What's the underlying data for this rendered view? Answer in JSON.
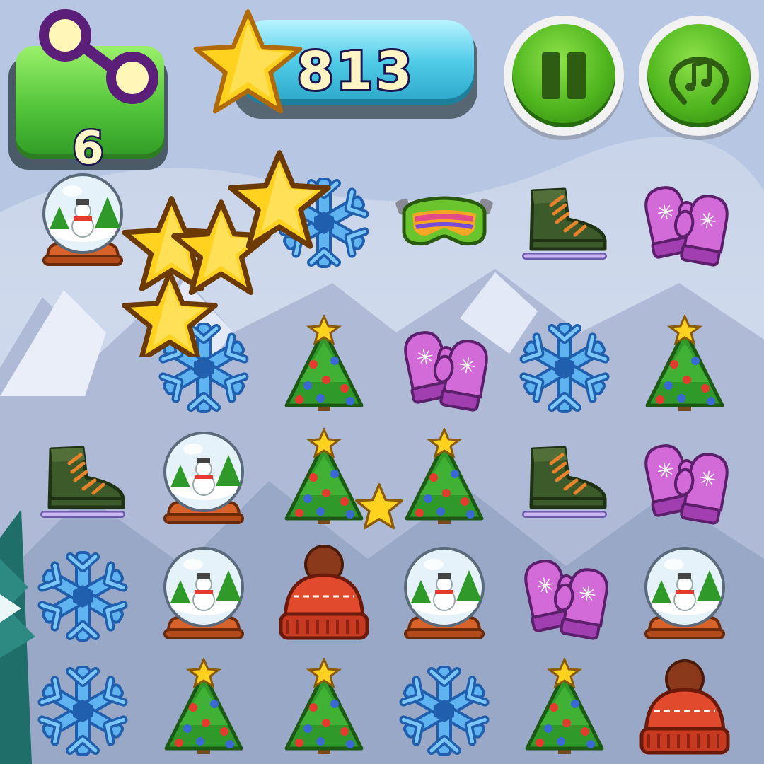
{
  "hud": {
    "moves_left": "6",
    "moves_icon": "link-chain-icon",
    "score": "813",
    "score_icon": "star-icon",
    "pause_icon": "pause-icon",
    "music_icon": "music-note-icon"
  },
  "board": {
    "columns": 6,
    "rows": 5,
    "tiles": [
      [
        "snow-globe",
        "",
        "snowflake",
        "ski-goggles",
        "ice-skate",
        "mittens"
      ],
      [
        "",
        "snowflake",
        "christmas-tree",
        "mittens",
        "snowflake",
        "christmas-tree"
      ],
      [
        "ice-skate",
        "snow-globe",
        "christmas-tree",
        "christmas-tree",
        "ice-skate",
        "mittens"
      ],
      [
        "snowflake",
        "snow-globe",
        "knit-hat",
        "snow-globe",
        "mittens",
        "snow-globe"
      ],
      [
        "snowflake",
        "christmas-tree",
        "christmas-tree",
        "snowflake",
        "christmas-tree",
        "knit-hat"
      ]
    ]
  },
  "effects": {
    "star_burst_icon": "star-burst-icon",
    "small_star_icon": "star-icon"
  },
  "colors": {
    "moves_green": "#52c43a",
    "score_cyan": "#4fcbe7",
    "button_green": "#4fb51e",
    "text_cream": "#fff4c4",
    "text_outline": "#1c1550"
  }
}
